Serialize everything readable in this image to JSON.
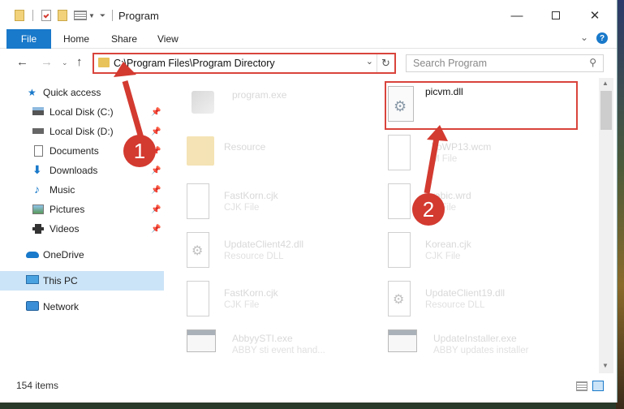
{
  "window": {
    "title": "Program"
  },
  "ribbon": {
    "file": "File",
    "home": "Home",
    "share": "Share",
    "view": "View",
    "help": "?"
  },
  "nav": {
    "address": "C:\\Program Files\\Program Directory",
    "search_placeholder": "Search Program"
  },
  "sidebar": {
    "items": [
      {
        "label": "Quick access",
        "icon": "star-icon"
      },
      {
        "label": "Local Disk (C:)",
        "icon": "drive-icon"
      },
      {
        "label": "Local Disk (D:)",
        "icon": "drive-icon"
      },
      {
        "label": "Documents",
        "icon": "documents-icon"
      },
      {
        "label": "Downloads",
        "icon": "downloads-icon"
      },
      {
        "label": "Music",
        "icon": "music-icon"
      },
      {
        "label": "Pictures",
        "icon": "pictures-icon"
      },
      {
        "label": "Videos",
        "icon": "videos-icon"
      },
      {
        "label": "OneDrive",
        "icon": "cloud-icon"
      },
      {
        "label": "This PC",
        "icon": "computer-icon"
      },
      {
        "label": "Network",
        "icon": "network-icon"
      }
    ]
  },
  "files": [
    {
      "name": "program.exe",
      "type": ""
    },
    {
      "name": "picvm.dll",
      "type": ""
    },
    {
      "name": "Resource",
      "type": ""
    },
    {
      "name": "ToWP13.wcm",
      "type": "M File"
    },
    {
      "name": "FastKorn.cjk",
      "type": "CJK File"
    },
    {
      "name": "rabic.wrd",
      "type": "D File"
    },
    {
      "name": "UpdateClient42.dll",
      "type": "Resource DLL"
    },
    {
      "name": "Korean.cjk",
      "type": "CJK File"
    },
    {
      "name": "FastKorn.cjk",
      "type": "CJK File"
    },
    {
      "name": "UpdateClient19.dll",
      "type": "Resource DLL"
    },
    {
      "name": "AbbyySTI.exe",
      "type": "ABBY sti event hand..."
    },
    {
      "name": "UpdateInstaller.exe",
      "type": "ABBY updates installer"
    }
  ],
  "status": {
    "count": "154 items"
  },
  "callouts": {
    "one": "1",
    "two": "2"
  },
  "colors": {
    "accent": "#1979ca",
    "callout": "#d33a30",
    "selection": "#cce4f7"
  }
}
